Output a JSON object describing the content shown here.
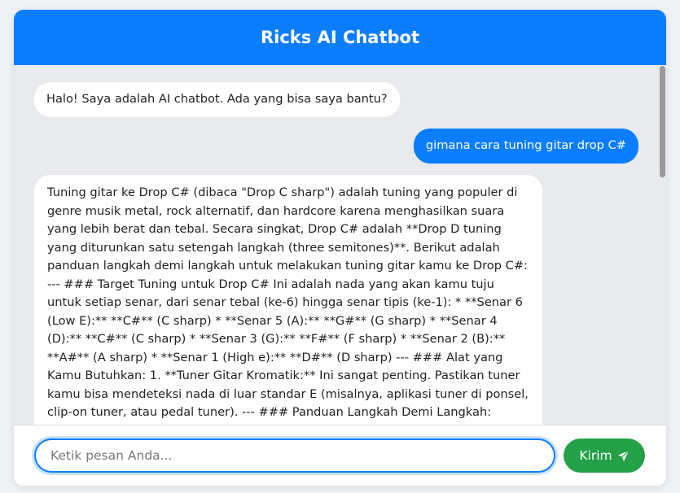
{
  "header": {
    "title": "Ricks AI Chatbot"
  },
  "messages": [
    {
      "sender": "bot",
      "text": "Halo! Saya adalah AI chatbot. Ada yang bisa saya bantu?"
    },
    {
      "sender": "user",
      "text": "gimana cara tuning gitar drop C#"
    },
    {
      "sender": "bot",
      "text": "Tuning gitar ke Drop C# (dibaca \"Drop C sharp\") adalah tuning yang populer di genre musik metal, rock alternatif, dan hardcore karena menghasilkan suara yang lebih berat dan tebal. Secara singkat, Drop C# adalah **Drop D tuning yang diturunkan satu setengah langkah (three semitones)**. Berikut adalah panduan langkah demi langkah untuk melakukan tuning gitar kamu ke Drop C#: --- ### Target Tuning untuk Drop C# Ini adalah nada yang akan kamu tuju untuk setiap senar, dari senar tebal (ke-6) hingga senar tipis (ke-1): * **Senar 6 (Low E):** **C#** (C sharp) * **Senar 5 (A):** **G#** (G sharp) * **Senar 4 (D):** **C#** (C sharp) * **Senar 3 (G):** **F#** (F sharp) * **Senar 2 (B):** **A#** (A sharp) * **Senar 1 (High e):** **D#** (D sharp) --- ### Alat yang Kamu Butuhkan: 1. **Tuner Gitar Kromatik:** Ini sangat penting. Pastikan tuner kamu bisa mendeteksi nada di luar standar E (misalnya, aplikasi tuner di ponsel, clip-on tuner, atau pedal tuner). --- ### Panduan Langkah Demi Langkah: **Penting:** Selalu putar knob tuner secara perlahan dan hati-hati. Turunkan setiap senar sedikit demi sedikit, lalu periksa kembali dengan tuner."
    }
  ],
  "input": {
    "placeholder": "Ketik pesan Anda...",
    "value": ""
  },
  "send_button": {
    "label": "Kirim",
    "icon": "paper-plane-icon"
  },
  "colors": {
    "primary": "#0b7dff",
    "send": "#24a148",
    "chat_bg": "#e8eaed"
  }
}
